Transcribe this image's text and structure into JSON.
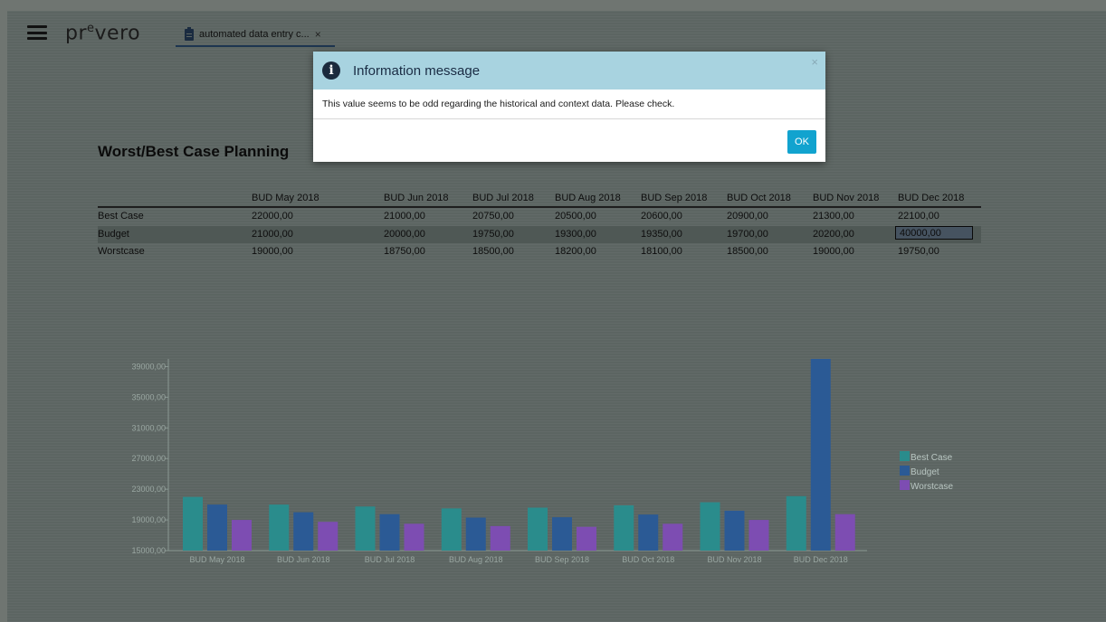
{
  "app": {
    "logo": "pr",
    "logo_sup": "e",
    "logo_tail": "vero"
  },
  "tab": {
    "label": "automated data entry c...",
    "close": "×"
  },
  "page": {
    "title": "Worst/Best Case Planning"
  },
  "table": {
    "columns": [
      "BUD May 2018",
      "BUD Jun 2018",
      "BUD Jul 2018",
      "BUD Aug 2018",
      "BUD Sep 2018",
      "BUD Oct 2018",
      "BUD Nov 2018",
      "BUD Dec 2018"
    ],
    "rows": [
      {
        "label": "Best Case",
        "values": [
          "22000,00",
          "21000,00",
          "20750,00",
          "20500,00",
          "20600,00",
          "20900,00",
          "21300,00",
          "22100,00"
        ]
      },
      {
        "label": "Budget",
        "values": [
          "21000,00",
          "20000,00",
          "19750,00",
          "19300,00",
          "19350,00",
          "19700,00",
          "20200,00",
          "40000,00"
        ]
      },
      {
        "label": "Worstcase",
        "values": [
          "19000,00",
          "18750,00",
          "18500,00",
          "18200,00",
          "18100,00",
          "18500,00",
          "19000,00",
          "19750,00"
        ]
      }
    ]
  },
  "dialog": {
    "title": "Information message",
    "message": "This value seems to be odd regarding the historical and context data. Please check.",
    "ok_label": "OK",
    "close": "×"
  },
  "colors": {
    "best_case": "#2a8c8c",
    "budget": "#2b5a95",
    "worstcase": "#7d4db2",
    "ok_button": "#11a3cf",
    "dialog_header": "#a8d3e0"
  },
  "chart_data": {
    "type": "bar",
    "categories": [
      "BUD May 2018",
      "BUD Jun 2018",
      "BUD Jul 2018",
      "BUD Aug 2018",
      "BUD Sep 2018",
      "BUD Oct 2018",
      "BUD Nov 2018",
      "BUD Dec 2018"
    ],
    "series": [
      {
        "name": "Best Case",
        "values": [
          22000,
          21000,
          20750,
          20500,
          20600,
          20900,
          21300,
          22100
        ]
      },
      {
        "name": "Budget",
        "values": [
          21000,
          20000,
          19750,
          19300,
          19350,
          19700,
          20200,
          40000
        ]
      },
      {
        "name": "Worstcase",
        "values": [
          19000,
          18750,
          18500,
          18200,
          18100,
          18500,
          19000,
          19750
        ]
      }
    ],
    "ylim": [
      15000,
      40000
    ],
    "yticks": [
      "39000,00",
      "35000,00",
      "31000,00",
      "27000,00",
      "23000,00",
      "19000,00",
      "15000,00"
    ],
    "ytick_values": [
      39000,
      35000,
      31000,
      27000,
      23000,
      19000,
      15000
    ],
    "legend_position": "right"
  }
}
